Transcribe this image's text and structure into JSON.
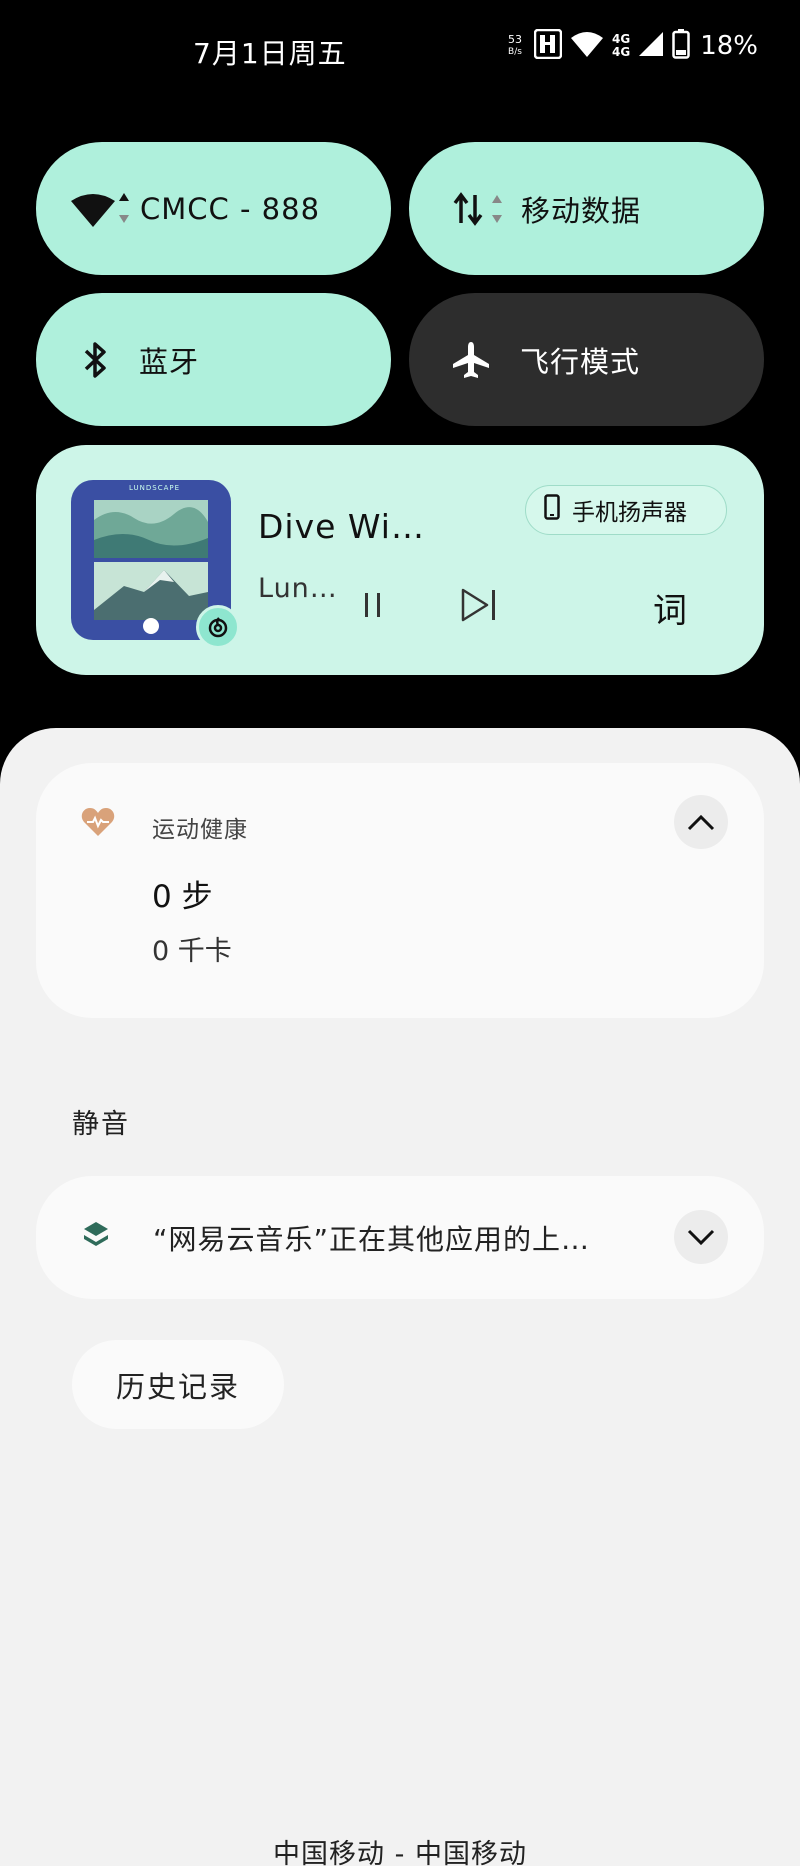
{
  "status_bar": {
    "date": "7月1日周五",
    "net_speed_value": "53",
    "net_speed_unit": "B/s",
    "network_4g_top": "4G",
    "network_4g_bottom": "4G",
    "battery": "18%"
  },
  "quick_settings": {
    "wifi": {
      "label": "CMCC - 888",
      "active": true
    },
    "mobile_data": {
      "label": "移动数据",
      "active": true
    },
    "bluetooth": {
      "label": "蓝牙",
      "active": true
    },
    "airplane": {
      "label": "飞行模式",
      "active": false
    }
  },
  "media": {
    "title": "Dive Wi…",
    "artist": "Lun…",
    "output_device": "手机扬声器",
    "lyrics_label": "词",
    "album_text": "LUNDSCAPE"
  },
  "notifications": {
    "health": {
      "app_name": "运动健康",
      "steps": "0 步",
      "calories": "0 千卡"
    },
    "silent_header": "静音",
    "netease": {
      "text": "“网易云音乐”正在其他应用的上…"
    },
    "history_button": "历史记录"
  },
  "carrier_text": "中国移动 - 中国移动",
  "colors": {
    "tile_active": "#aff0dc",
    "tile_inactive": "#2d2d2d",
    "media_card": "#cdf5e8",
    "sheet": "#f2f2f2",
    "health_heart": "#d9a27a"
  }
}
